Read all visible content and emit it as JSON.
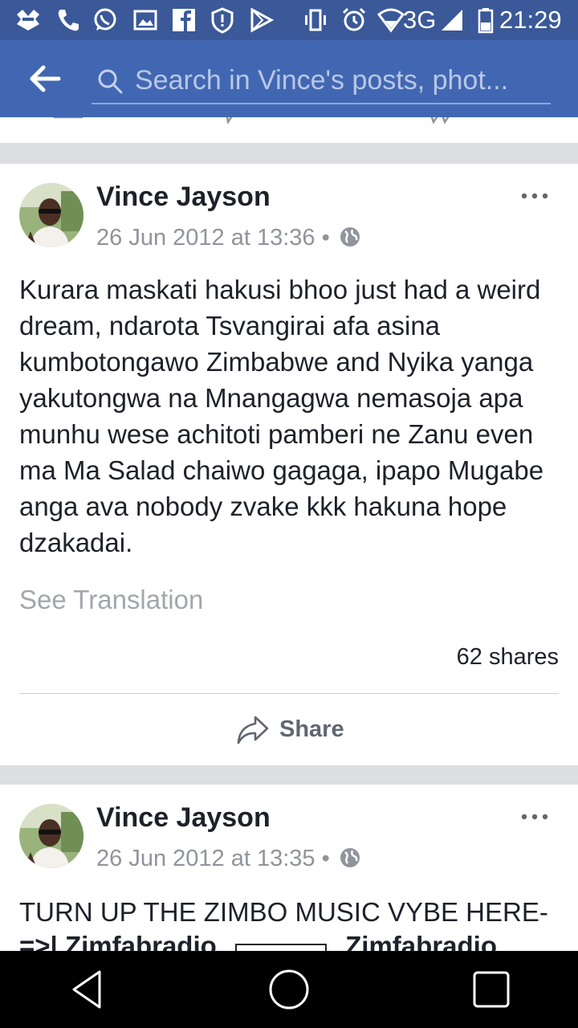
{
  "status_bar": {
    "network": "3G",
    "time": "21:29"
  },
  "header": {
    "search_placeholder": "Search in Vince's posts, phot..."
  },
  "posts": [
    {
      "author": "Vince Jayson",
      "timestamp": "26 Jun 2012 at 13:36",
      "separator": "•",
      "text": "Kurara maskati hakusi bhoo just had a weird dream, ndarota Tsvangirai afa asina kumbotongawo Zimbabwe and Nyika yanga yakutongwa na Mnangagwa nemasoja apa munhu wese achitoti pamberi ne Zanu even ma Ma Salad chaiwo gagaga, ipapo Mugabe anga ava nobody zvake kkk hakuna hope dzakadai.",
      "see_translation": "See Translation",
      "shares": "62 shares",
      "share_label": "Share"
    },
    {
      "author": "Vince Jayson",
      "timestamp": "26 Jun 2012 at 13:35",
      "separator": "•",
      "text": "TURN UP THE ZIMBO MUSIC VYBE HERE-",
      "link_text": "=>| Zimfabradio ",
      "link_text2": " Zimfabradio"
    }
  ],
  "colors": {
    "status_bar": "#3b5998",
    "header": "#4267b2",
    "feed_bg": "#dddfe2"
  }
}
